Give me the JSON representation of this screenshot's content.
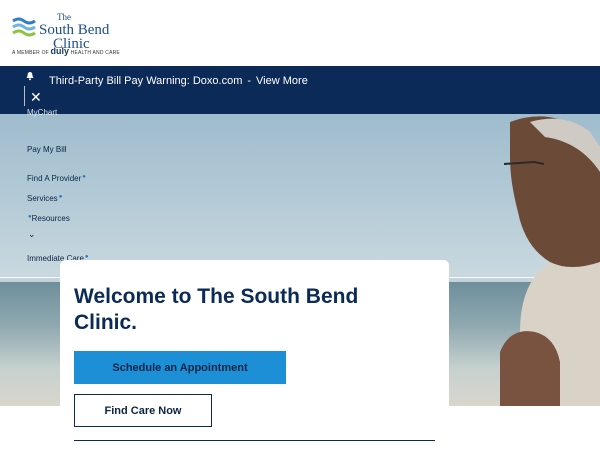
{
  "header": {
    "logo_the": "The",
    "logo_line1": "South Bend",
    "logo_line2": "Clinic",
    "member_prefix": "A MEMBER OF",
    "member_brand": "duly",
    "member_suffix": "HEALTH AND CARE"
  },
  "alert": {
    "text": "Third-Party Bill Pay Warning: Doxo.com",
    "separator": "-",
    "link": "View More",
    "icon": "bell-icon",
    "close_icon": "close-icon"
  },
  "menu": {
    "items": [
      {
        "label": "MyChart"
      },
      {
        "label": "Pay My Bill"
      },
      {
        "label": "Find A Provider"
      },
      {
        "label": "Services"
      },
      {
        "label": "Resources"
      },
      {
        "label": "Immediate Care"
      }
    ]
  },
  "hero": {
    "title": "Welcome to The South Bend Clinic.",
    "primary_button": "Schedule an Appointment",
    "secondary_button": "Find Care Now"
  },
  "colors": {
    "navy": "#0b2a57",
    "accent_blue": "#1d8fd6",
    "white": "#ffffff"
  }
}
